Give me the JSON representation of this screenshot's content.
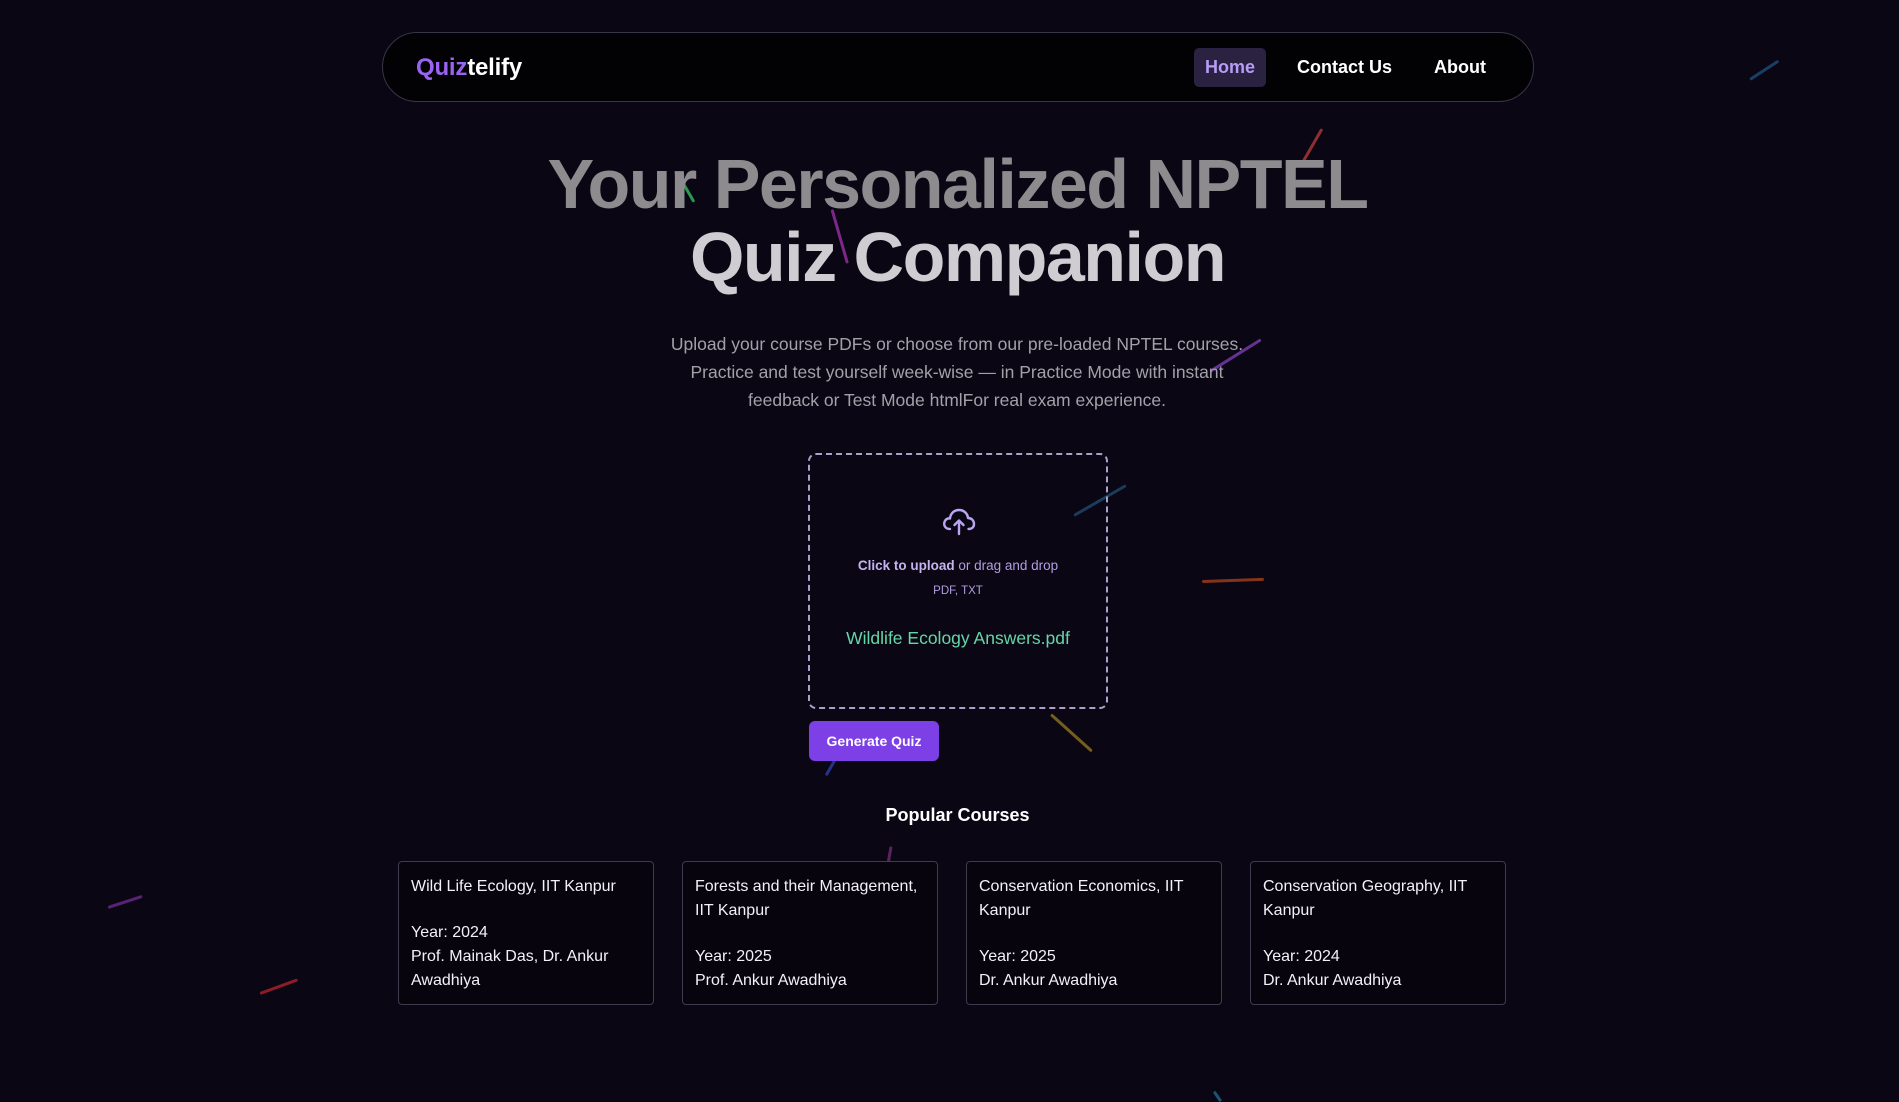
{
  "nav": {
    "brand_part1": "Quiz",
    "brand_part2": "telify",
    "links": [
      {
        "label": "Home",
        "active": true
      },
      {
        "label": "Contact Us",
        "active": false
      },
      {
        "label": "About",
        "active": false
      }
    ]
  },
  "hero": {
    "title_line1": "Your Personalized NPTEL",
    "title_line2": "Quiz Companion",
    "subtitle": "Upload your course PDFs or choose from our pre-loaded NPTEL courses. Practice and test yourself week-wise — in Practice Mode with instant feedback or Test Mode htmlFor real exam experience."
  },
  "upload": {
    "icon": "cloud-upload-icon",
    "click_text": "Click to upload",
    "drag_text": " or drag and drop",
    "file_types": "PDF, TXT",
    "file_name": "Wildlife Ecology Answers.pdf",
    "generate_label": "Generate Quiz"
  },
  "courses": {
    "title": "Popular Courses",
    "items": [
      {
        "name": "Wild Life Ecology, IIT Kanpur",
        "year": "Year: 2024",
        "professor": "Prof. Mainak Das, Dr. Ankur Awadhiya"
      },
      {
        "name": "Forests and their Management, IIT Kanpur",
        "year": "Year: 2025",
        "professor": "Prof. Ankur Awadhiya"
      },
      {
        "name": "Conservation Economics, IIT Kanpur",
        "year": "Year: 2025",
        "professor": "Dr. Ankur Awadhiya"
      },
      {
        "name": "Conservation Geography, IIT Kanpur",
        "year": "Year: 2024",
        "professor": "Dr. Ankur Awadhiya"
      }
    ]
  },
  "colors": {
    "background": "#0a0614",
    "accent": "#7d3fe6",
    "brand": "#9a63f2",
    "file_name": "#66d6a6"
  }
}
